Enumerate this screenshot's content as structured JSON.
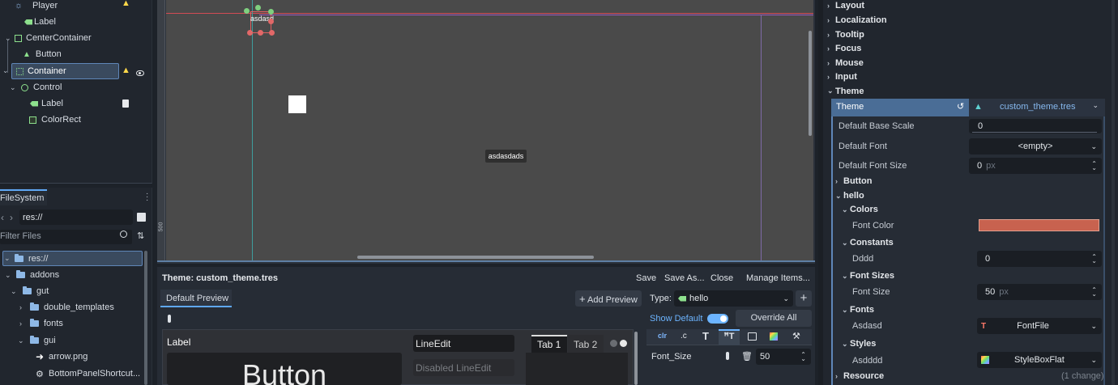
{
  "scene_tree": {
    "items": [
      {
        "label": "Player",
        "warn": true
      },
      {
        "label": "Label",
        "warn": false
      },
      {
        "label": "CenterContainer",
        "warn": false
      },
      {
        "label": "Button",
        "warn": false
      },
      {
        "label": "Container",
        "warn": true
      },
      {
        "label": "Control",
        "warn": false
      },
      {
        "label": "Label",
        "warn": false
      },
      {
        "label": "ColorRect",
        "warn": false
      }
    ]
  },
  "filesystem": {
    "tab": "FileSystem",
    "path": "res://",
    "filter_placeholder": "Filter Files",
    "items": [
      "res://",
      "addons",
      "gut",
      "double_templates",
      "fonts",
      "gui",
      "arrow.png",
      "BottomPanelShortcut..."
    ]
  },
  "viewport": {
    "selected_label": "asdasd",
    "center_label": "asdasdads",
    "ruler_mark": "500"
  },
  "theme_editor": {
    "title": "Theme: custom_theme.tres",
    "actions": [
      "Save",
      "Save As...",
      "Close",
      "Manage Items..."
    ],
    "preview_tab": "Default Preview",
    "add_preview": "Add Preview",
    "type_label": "Type:",
    "type_value": "hello",
    "show_default": "Show Default",
    "override_all": "Override All",
    "property_name": "Font_Size",
    "property_value": "50",
    "preview": {
      "label": "Label",
      "button": "Button",
      "lineedit": "LineEdit",
      "disabled_lineedit": "Disabled LineEdit",
      "tab1": "Tab 1",
      "tab2": "Tab 2"
    }
  },
  "inspector": {
    "groups": [
      "Layout",
      "Localization",
      "Tooltip",
      "Focus",
      "Mouse",
      "Input",
      "Theme"
    ],
    "theme_label": "Theme",
    "theme_file": "custom_theme.tres",
    "default_base_scale_label": "Default Base Scale",
    "default_base_scale": "0",
    "default_font_label": "Default Font",
    "default_font": "<empty>",
    "default_font_size_label": "Default Font Size",
    "default_font_size": "0",
    "px": "px",
    "button_section": "Button",
    "hello_section": "hello",
    "colors": "Colors",
    "font_color_label": "Font Color",
    "font_color": "#c8624f",
    "constants": "Constants",
    "dddd_label": "Dddd",
    "dddd_value": "0",
    "font_sizes": "Font Sizes",
    "font_size_label": "Font Size",
    "font_size_value": "50",
    "fonts": "Fonts",
    "asdasd_label": "Asdasd",
    "asdasd_value": "FontFile",
    "styles": "Styles",
    "asdddd_label": "Asdddd",
    "asdddd_value": "StyleBoxFlat",
    "resource": "Resource",
    "resource_changes": "(1 change)"
  },
  "colors": {
    "accent": "#5fa8f5",
    "bg": "#1d2229",
    "canvas": "#4a4a4a"
  }
}
